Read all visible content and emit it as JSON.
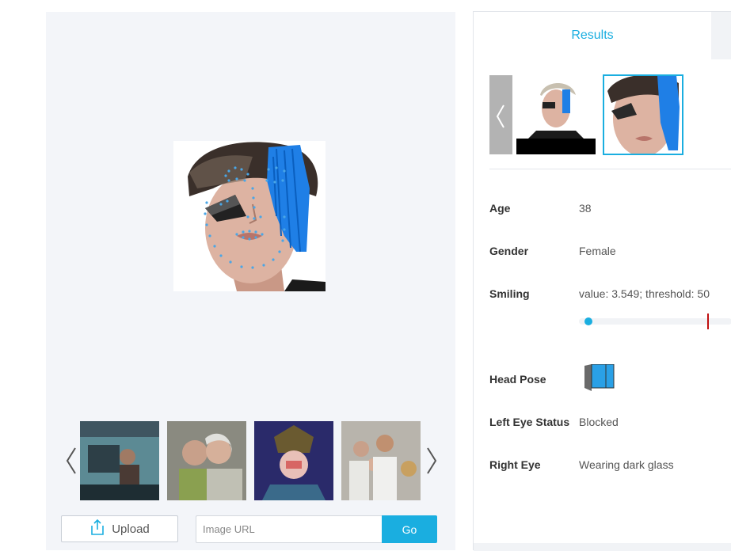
{
  "thumbnails": [
    {
      "name": "thumb-car",
      "alt": "people in car"
    },
    {
      "name": "thumb-couple",
      "alt": "elderly couple"
    },
    {
      "name": "thumb-opera",
      "alt": "opera performer"
    },
    {
      "name": "thumb-family",
      "alt": "family with dog"
    }
  ],
  "upload": {
    "label": "Upload"
  },
  "url_input": {
    "placeholder": "Image URL",
    "value": ""
  },
  "go": {
    "label": "Go"
  },
  "results": {
    "tab_label": "Results",
    "rows": {
      "age": {
        "label": "Age",
        "value": "38"
      },
      "gender": {
        "label": "Gender",
        "value": "Female"
      },
      "smiling": {
        "label": "Smiling",
        "value": "value: 3.549; threshold: 50",
        "score": 3.549,
        "threshold": 50,
        "max": 100
      },
      "head_pose": {
        "label": "Head Pose"
      },
      "left_eye": {
        "label": "Left Eye Status",
        "value": "Blocked"
      },
      "right_eye": {
        "label": "Right Eye",
        "value": "Wearing dark glass"
      }
    }
  },
  "colors": {
    "accent": "#1aaee0",
    "threshold": "#c01010",
    "landmark": "#4aa6e6",
    "hair_blue": "#1f7fe6"
  },
  "icons": {
    "prev": "chevron-left-icon",
    "next": "chevron-right-icon",
    "upload": "upload-icon",
    "head_pose": "head-pose-icon"
  }
}
